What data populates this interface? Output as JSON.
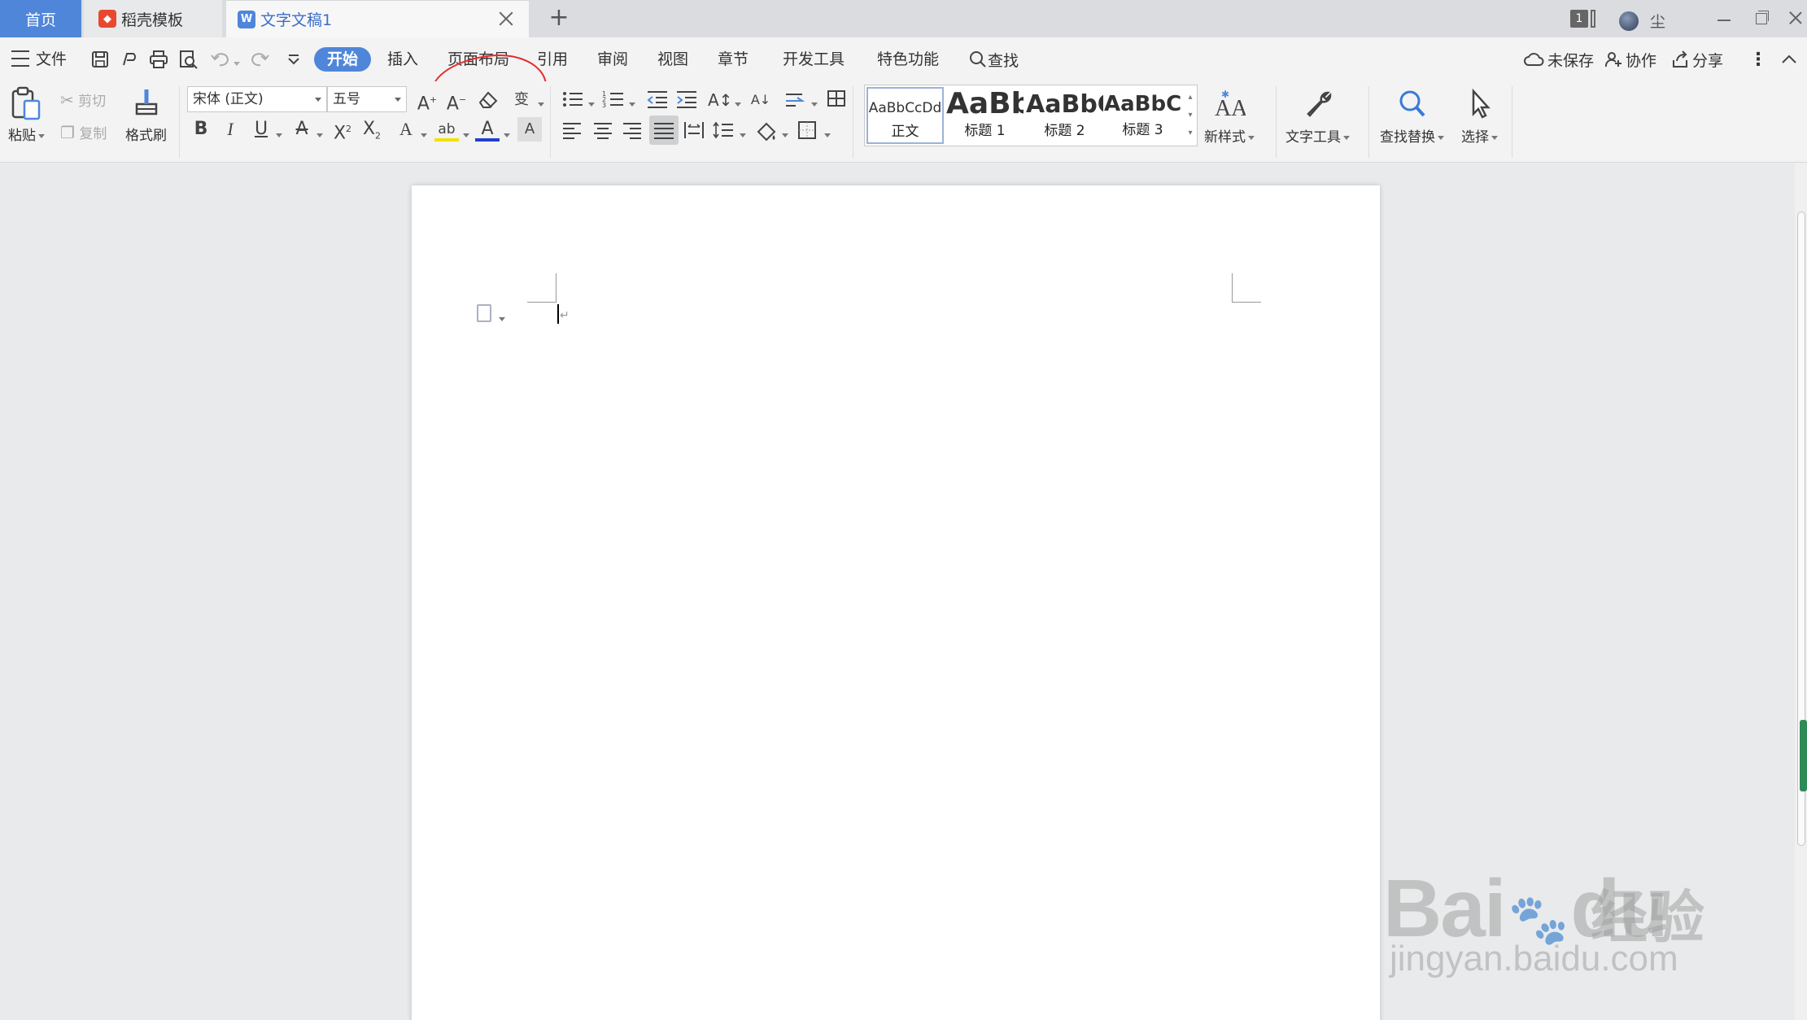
{
  "tabs": {
    "home": "首页",
    "template": "稻壳模板",
    "doc": "文字文稿1",
    "doc_icon": "W",
    "add": "+"
  },
  "window": {
    "count": "1",
    "user": "尘"
  },
  "menu": {
    "file": "文件",
    "items": [
      "开始",
      "插入",
      "页面布局",
      "引用",
      "审阅",
      "视图",
      "章节",
      "开发工具",
      "特色功能"
    ],
    "find": "查找",
    "unsaved": "未保存",
    "collab": "协作",
    "share": "分享"
  },
  "ribbon": {
    "paste": "粘贴",
    "cut": "剪切",
    "copy": "复制",
    "format_painter": "格式刷",
    "font_name": "宋体 (正文)",
    "font_size": "五号",
    "styles": [
      {
        "sample": "AaBbCcDd",
        "label": "正文"
      },
      {
        "sample": "AaBb",
        "label": "标题 1"
      },
      {
        "sample": "AaBbC",
        "label": "标题 2"
      },
      {
        "sample": "AaBbCc",
        "label": "标题 3"
      }
    ],
    "new_style": "新样式",
    "text_tools": "文字工具",
    "find_replace": "查找替换",
    "select": "选择"
  },
  "watermark": {
    "brand_a": "Bai",
    "brand_b": "du",
    "brand_cn": "经验",
    "url": "jingyan.baidu.com"
  },
  "colors": {
    "accent": "#4f86d9",
    "annotation_circle": "#e52b2b"
  }
}
